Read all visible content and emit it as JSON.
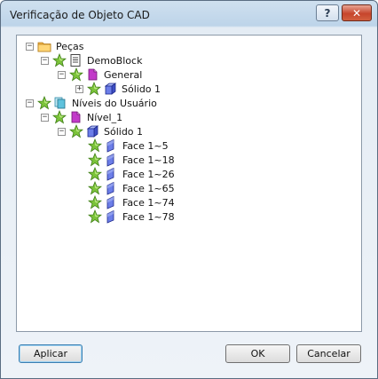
{
  "window": {
    "title": "Verificação de Objeto CAD",
    "help_label": "?",
    "close_label": "✕"
  },
  "tree": {
    "pecas": "Peças",
    "demoblock": "DemoBlock",
    "general": "General",
    "solido_general": "Sólido 1",
    "niveis": "Níveis do Usuário",
    "nivel1": "Nível_1",
    "solido_nivel": "Sólido 1",
    "faces": [
      "Face 1~5",
      "Face 1~18",
      "Face 1~26",
      "Face 1~65",
      "Face 1~74",
      "Face 1~78"
    ],
    "expander_open": "−",
    "expander_closed": "+"
  },
  "buttons": {
    "apply": "Aplicar",
    "ok": "OK",
    "cancel": "Cancelar"
  },
  "colors": {
    "star": "#7cc43a",
    "folder": "#f3b54a",
    "solid": "#4a5ed6",
    "layer": "#c23ac9"
  }
}
